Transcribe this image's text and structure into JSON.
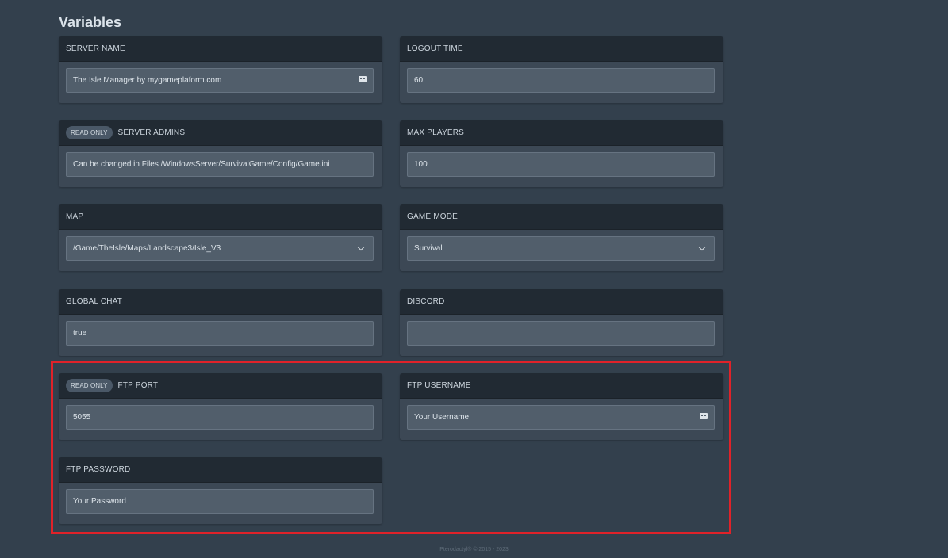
{
  "page": {
    "title": "Variables"
  },
  "variables": [
    {
      "label": "SERVER NAME",
      "read_only": false,
      "value": "The Isle Manager by mygameplaform.com",
      "control": "text",
      "icon": "password-manager-icon"
    },
    {
      "label": "LOGOUT TIME",
      "read_only": false,
      "value": "60",
      "control": "text"
    },
    {
      "label": "SERVER ADMINS",
      "read_only": true,
      "value": "Can be changed in Files /WindowsServer/SurvivalGame/Config/Game.ini",
      "control": "text"
    },
    {
      "label": "MAX PLAYERS",
      "read_only": false,
      "value": "100",
      "control": "text"
    },
    {
      "label": "MAP",
      "read_only": false,
      "value": "/Game/TheIsle/Maps/Landscape3/Isle_V3",
      "control": "select"
    },
    {
      "label": "GAME MODE",
      "read_only": false,
      "value": "Survival",
      "control": "select"
    },
    {
      "label": "GLOBAL CHAT",
      "read_only": false,
      "value": "true",
      "control": "text"
    },
    {
      "label": "DISCORD",
      "read_only": false,
      "value": "",
      "control": "text"
    },
    {
      "label": "FTP PORT",
      "read_only": true,
      "value": "5055",
      "control": "text"
    },
    {
      "label": "FTP USERNAME",
      "read_only": false,
      "value": "Your Username",
      "control": "text",
      "icon": "password-manager-icon"
    },
    {
      "label": "FTP PASSWORD",
      "read_only": false,
      "value": "Your Password",
      "control": "text"
    }
  ],
  "badges": {
    "read_only": "READ ONLY"
  },
  "highlight": {
    "color": "#e02229"
  },
  "footer": {
    "text": "Pterodactyl® © 2015 - 2023"
  }
}
